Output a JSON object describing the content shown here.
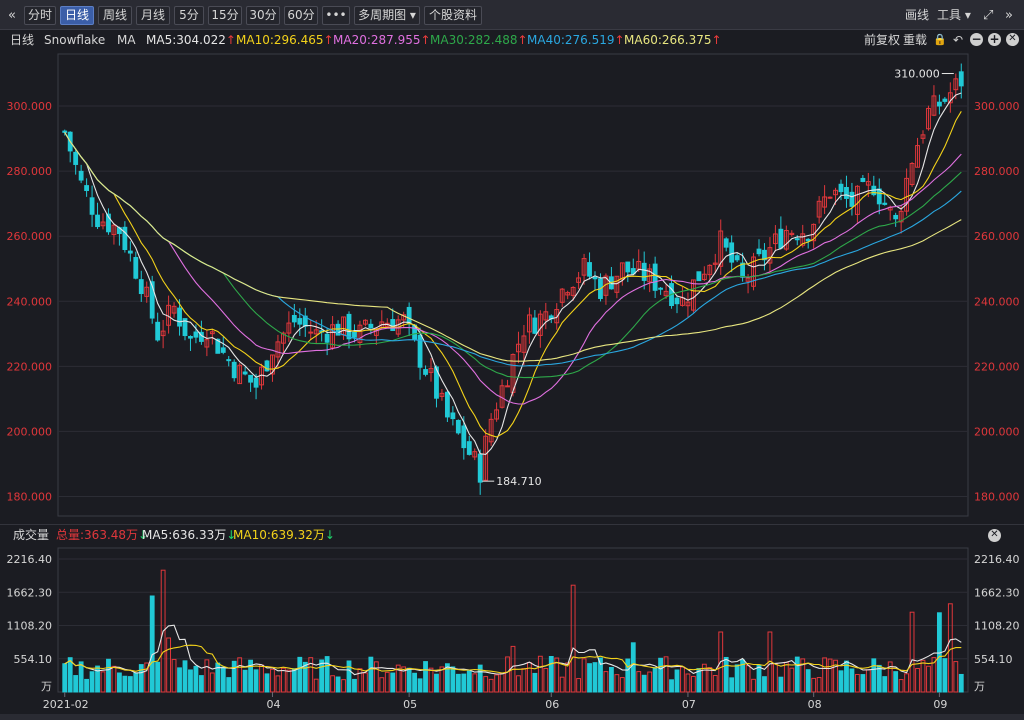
{
  "toolbar": {
    "back_icon": "«",
    "buttons": [
      "分时",
      "日线",
      "周线",
      "月线",
      "5分",
      "15分",
      "30分",
      "60分",
      "•••",
      "多周期图 ▾",
      "个股资料"
    ],
    "active": "日线",
    "right_draw": "画线",
    "right_tools": "工具 ▾",
    "expand_icon": "⤢",
    "forward_icon": "»"
  },
  "ma_header": {
    "period": "日线",
    "symbol": "Snowflake",
    "label": "MA",
    "items": [
      {
        "text": "MA5:304.022",
        "color": "#e6e6e6"
      },
      {
        "text": "MA10:296.465",
        "color": "#f3d21a"
      },
      {
        "text": "MA20:287.955",
        "color": "#e070e0"
      },
      {
        "text": "MA30:282.488",
        "color": "#2ea84a"
      },
      {
        "text": "MA40:276.519",
        "color": "#2aa7e0"
      },
      {
        "text": "MA60:266.375",
        "color": "#e8e680"
      }
    ],
    "arrow": "↑",
    "adjust": "前复权",
    "overlay": "重载",
    "lock_icon": "🔒",
    "undo_icon": "↶",
    "zoom_out_icon": "−",
    "zoom_in_icon": "+"
  },
  "volume_header": {
    "label": "成交量",
    "total": "总量:363.48万",
    "ma5": "MA5:636.33万",
    "ma10": "MA10:639.32万",
    "down_arrow": "↓",
    "close_icon": "✕"
  },
  "colors": {
    "up": "#e0373b",
    "down": "#21c9d6",
    "ma5": "#e6e6e6",
    "ma10": "#f3d21a",
    "ma20": "#e070e0",
    "ma30": "#2ea84a",
    "ma40": "#2aa7e0",
    "ma60": "#e8e680"
  },
  "chart_data": [
    {
      "type": "candlestick",
      "ylim": [
        174,
        316
      ],
      "y_ticks": [
        "300.000",
        "280.000",
        "260.000",
        "240.000",
        "220.000",
        "200.000",
        "180.000"
      ],
      "y_tick_values": [
        300,
        280,
        260,
        240,
        220,
        200,
        180
      ],
      "x_ticks": [
        {
          "label": "2021-02",
          "index": 0
        },
        {
          "label": "04",
          "index": 38
        },
        {
          "label": "05",
          "index": 63
        },
        {
          "label": "06",
          "index": 89
        },
        {
          "label": "07",
          "index": 114
        },
        {
          "label": "08",
          "index": 137
        },
        {
          "label": "09",
          "index": 160
        }
      ],
      "annotations": [
        {
          "text": "310.000",
          "value": 310.0,
          "index": 163,
          "side": "left"
        },
        {
          "text": "184.710",
          "value": 184.71,
          "index": 76,
          "side": "right"
        }
      ],
      "keyframes": [
        [
          0,
          292
        ],
        [
          3,
          276
        ],
        [
          6,
          266
        ],
        [
          10,
          262
        ],
        [
          14,
          246
        ],
        [
          17,
          230
        ],
        [
          20,
          238
        ],
        [
          23,
          228
        ],
        [
          26,
          232
        ],
        [
          29,
          224
        ],
        [
          32,
          218
        ],
        [
          35,
          214
        ],
        [
          38,
          226
        ],
        [
          42,
          234
        ],
        [
          46,
          230
        ],
        [
          50,
          232
        ],
        [
          54,
          230
        ],
        [
          58,
          234
        ],
        [
          62,
          234
        ],
        [
          64,
          226
        ],
        [
          67,
          216
        ],
        [
          70,
          204
        ],
        [
          73,
          196
        ],
        [
          76,
          188
        ],
        [
          78,
          204
        ],
        [
          81,
          218
        ],
        [
          84,
          232
        ],
        [
          88,
          236
        ],
        [
          92,
          246
        ],
        [
          95,
          250
        ],
        [
          98,
          244
        ],
        [
          102,
          250
        ],
        [
          106,
          248
        ],
        [
          110,
          244
        ],
        [
          113,
          240
        ],
        [
          116,
          248
        ],
        [
          120,
          258
        ],
        [
          124,
          246
        ],
        [
          128,
          254
        ],
        [
          132,
          262
        ],
        [
          136,
          262
        ],
        [
          140,
          274
        ],
        [
          144,
          270
        ],
        [
          148,
          276
        ],
        [
          152,
          264
        ],
        [
          155,
          284
        ],
        [
          158,
          298
        ],
        [
          161,
          302
        ],
        [
          164,
          308
        ]
      ],
      "n": 165,
      "ma_periods": [
        5,
        10,
        20,
        30,
        40,
        60
      ]
    },
    {
      "type": "bar",
      "ylim": [
        0,
        2400
      ],
      "y_ticks": [
        "2216.40",
        "1662.30",
        "1108.20",
        "554.10",
        "万"
      ],
      "y_tick_values": [
        2216.4,
        1662.3,
        1108.2,
        554.1,
        0
      ],
      "volume_peaks": [
        {
          "index": 16,
          "value": 1600
        },
        {
          "index": 18,
          "value": 2030
        },
        {
          "index": 19,
          "value": 900
        },
        {
          "index": 82,
          "value": 760
        },
        {
          "index": 93,
          "value": 1780
        },
        {
          "index": 104,
          "value": 820
        },
        {
          "index": 120,
          "value": 1000
        },
        {
          "index": 129,
          "value": 1000
        },
        {
          "index": 155,
          "value": 1330
        },
        {
          "index": 160,
          "value": 1320
        },
        {
          "index": 162,
          "value": 1470
        }
      ],
      "ma_periods": [
        5,
        10
      ]
    }
  ]
}
